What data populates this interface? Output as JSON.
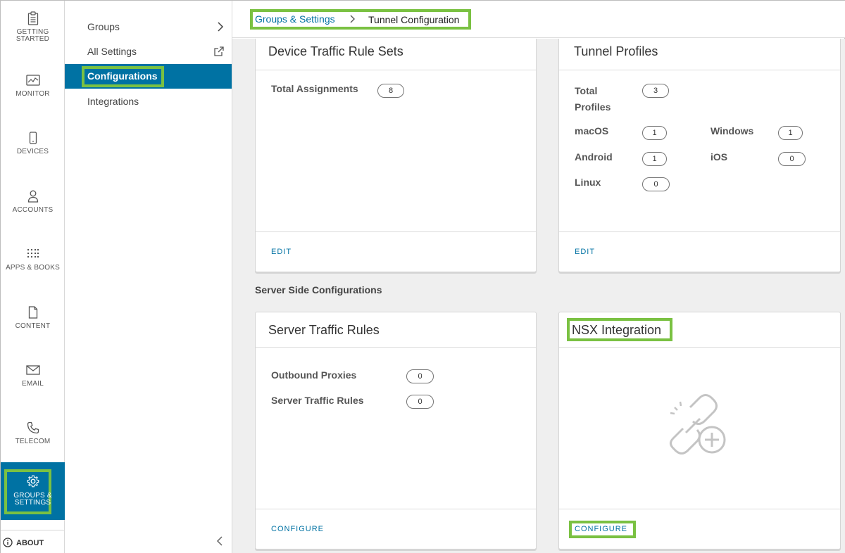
{
  "rail": {
    "items": [
      {
        "label_l1": "GETTING",
        "label_l2": "STARTED",
        "icon": "clipboard-icon"
      },
      {
        "label_l1": "MONITOR",
        "label_l2": "",
        "icon": "monitor-chart-icon"
      },
      {
        "label_l1": "DEVICES",
        "label_l2": "",
        "icon": "phone-icon"
      },
      {
        "label_l1": "ACCOUNTS",
        "label_l2": "",
        "icon": "user-icon"
      },
      {
        "label_l1": "APPS & BOOKS",
        "label_l2": "",
        "icon": "grid-dots-icon"
      },
      {
        "label_l1": "CONTENT",
        "label_l2": "",
        "icon": "document-icon"
      },
      {
        "label_l1": "EMAIL",
        "label_l2": "",
        "icon": "envelope-icon"
      },
      {
        "label_l1": "TELECOM",
        "label_l2": "",
        "icon": "phone-handset-icon"
      },
      {
        "label_l1": "GROUPS &",
        "label_l2": "SETTINGS",
        "icon": "gear-icon"
      }
    ],
    "about": "ABOUT"
  },
  "subnav": {
    "items": [
      {
        "label": "Groups"
      },
      {
        "label": "All Settings"
      },
      {
        "label": "Configurations"
      },
      {
        "label": "Integrations"
      }
    ]
  },
  "breadcrumb": {
    "parent": "Groups & Settings",
    "current": "Tunnel Configuration"
  },
  "cards": {
    "device_traffic": {
      "title": "Device Traffic Rule Sets",
      "total_label": "Total Assignments",
      "total_value": "8",
      "action": "EDIT"
    },
    "tunnel_profiles": {
      "title": "Tunnel Profiles",
      "total_label_l1": "Total",
      "total_label_l2": "Profiles",
      "total_value": "3",
      "macos_label": "macOS",
      "macos_value": "1",
      "windows_label": "Windows",
      "windows_value": "1",
      "android_label": "Android",
      "android_value": "1",
      "ios_label": "iOS",
      "ios_value": "0",
      "linux_label": "Linux",
      "linux_value": "0",
      "action": "EDIT"
    },
    "section_label": "Server Side Configurations",
    "server_traffic": {
      "title": "Server Traffic Rules",
      "proxies_label": "Outbound Proxies",
      "proxies_value": "0",
      "rules_label": "Server Traffic Rules",
      "rules_value": "0",
      "action": "CONFIGURE"
    },
    "nsx": {
      "title": "NSX Integration",
      "action": "CONFIGURE"
    }
  },
  "colors": {
    "accent": "#0072a3",
    "highlight": "#7ac142",
    "background": "#efefef"
  }
}
